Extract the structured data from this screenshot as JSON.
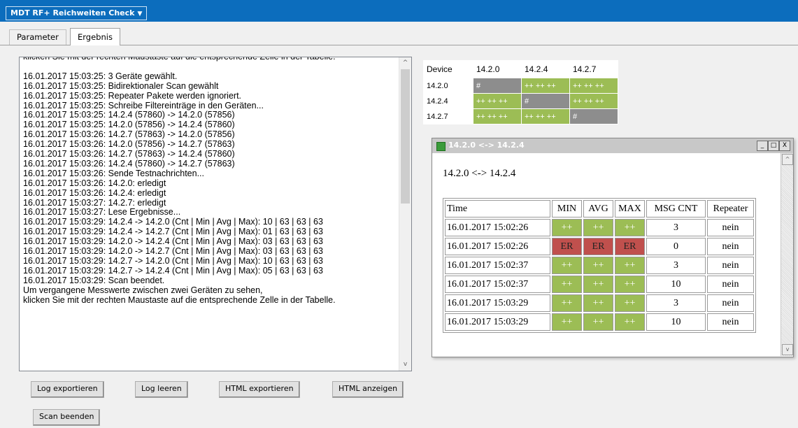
{
  "app": {
    "title": "MDT RF+ Reichweiten Check",
    "caret": "▼"
  },
  "tabs": [
    {
      "label": "Parameter",
      "active": false
    },
    {
      "label": "Ergebnis",
      "active": true
    }
  ],
  "log": {
    "lines": [
      "klicken Sie mit der rechten Maustaste auf die entsprechende Zelle in der Tabelle.",
      "",
      "16.01.2017 15:03:25: 3 Geräte gewählt.",
      "16.01.2017 15:03:25: Bidirektionaler Scan gewählt",
      "16.01.2017 15:03:25: Repeater Pakete werden ignoriert.",
      "16.01.2017 15:03:25: Schreibe Filtereinträge in den Geräten...",
      "16.01.2017 15:03:25: 14.2.4 (57860) -> 14.2.0 (57856)",
      "16.01.2017 15:03:25: 14.2.0 (57856) -> 14.2.4 (57860)",
      "16.01.2017 15:03:26: 14.2.7 (57863) -> 14.2.0 (57856)",
      "16.01.2017 15:03:26: 14.2.0 (57856) -> 14.2.7 (57863)",
      "16.01.2017 15:03:26: 14.2.7 (57863) -> 14.2.4 (57860)",
      "16.01.2017 15:03:26: 14.2.4 (57860) -> 14.2.7 (57863)",
      "16.01.2017 15:03:26: Sende Testnachrichten...",
      "16.01.2017 15:03:26: 14.2.0: erledigt",
      "16.01.2017 15:03:26: 14.2.4: erledigt",
      "16.01.2017 15:03:27: 14.2.7: erledigt",
      "16.01.2017 15:03:27: Lese Ergebnisse...",
      "16.01.2017 15:03:29: 14.2.4 -> 14.2.0 (Cnt | Min | Avg | Max): 10 | 63 | 63 | 63",
      "16.01.2017 15:03:29: 14.2.4 -> 14.2.7 (Cnt | Min | Avg | Max): 01 | 63 | 63 | 63",
      "16.01.2017 15:03:29: 14.2.0 -> 14.2.4 (Cnt | Min | Avg | Max): 03 | 63 | 63 | 63",
      "16.01.2017 15:03:29: 14.2.0 -> 14.2.7 (Cnt | Min | Avg | Max): 03 | 63 | 63 | 63",
      "16.01.2017 15:03:29: 14.2.7 -> 14.2.0 (Cnt | Min | Avg | Max): 10 | 63 | 63 | 63",
      "16.01.2017 15:03:29: 14.2.7 -> 14.2.4 (Cnt | Min | Avg | Max): 05 | 63 | 63 | 63",
      "16.01.2017 15:03:29: Scan beendet.",
      "Um vergangene Messwerte zwischen zwei Geräten zu sehen,",
      "klicken Sie mit der rechten Maustaste auf die entsprechende Zelle in der Tabelle."
    ],
    "scroll_up": "^",
    "scroll_down": "v"
  },
  "buttons": {
    "log_export": "Log exportieren",
    "log_clear": "Log leeren",
    "html_export": "HTML exportieren",
    "html_show": "HTML anzeigen",
    "scan_stop": "Scan beenden"
  },
  "matrix": {
    "header": [
      "Device",
      "14.2.0",
      "14.2.4",
      "14.2.7"
    ],
    "rows": [
      {
        "device": "14.2.0",
        "cells": [
          "#",
          "++ ++ ++",
          "++ ++ ++"
        ]
      },
      {
        "device": "14.2.4",
        "cells": [
          "++ ++ ++",
          "#",
          "++ ++ ++"
        ]
      },
      {
        "device": "14.2.7",
        "cells": [
          "++ ++ ++",
          "++ ++ ++",
          "#"
        ]
      }
    ]
  },
  "popup": {
    "title": "14.2.0 <-> 14.2.4",
    "heading": "14.2.0 <-> 14.2.4",
    "controls": {
      "minimize": "_",
      "maximize": "□",
      "close": "X"
    },
    "columns": [
      "Time",
      "MIN",
      "AVG",
      "MAX",
      "MSG CNT",
      "Repeater"
    ],
    "rows": [
      {
        "time": "16.01.2017 15:02:26",
        "min": "++",
        "avg": "++",
        "max": "++",
        "msg_cnt": "3",
        "repeater": "nein",
        "status": "ok"
      },
      {
        "time": "16.01.2017 15:02:26",
        "min": "ER",
        "avg": "ER",
        "max": "ER",
        "msg_cnt": "0",
        "repeater": "nein",
        "status": "error"
      },
      {
        "time": "16.01.2017 15:02:37",
        "min": "++",
        "avg": "++",
        "max": "++",
        "msg_cnt": "3",
        "repeater": "nein",
        "status": "ok"
      },
      {
        "time": "16.01.2017 15:02:37",
        "min": "++",
        "avg": "++",
        "max": "++",
        "msg_cnt": "10",
        "repeater": "nein",
        "status": "ok"
      },
      {
        "time": "16.01.2017 15:03:29",
        "min": "++",
        "avg": "++",
        "max": "++",
        "msg_cnt": "3",
        "repeater": "nein",
        "status": "ok"
      },
      {
        "time": "16.01.2017 15:03:29",
        "min": "++",
        "avg": "++",
        "max": "++",
        "msg_cnt": "10",
        "repeater": "nein",
        "status": "ok"
      }
    ]
  },
  "colors": {
    "titlebar": "#0c6dbd",
    "good": "#9cbd55",
    "error": "#c0504d",
    "self": "#8d8d8d"
  }
}
